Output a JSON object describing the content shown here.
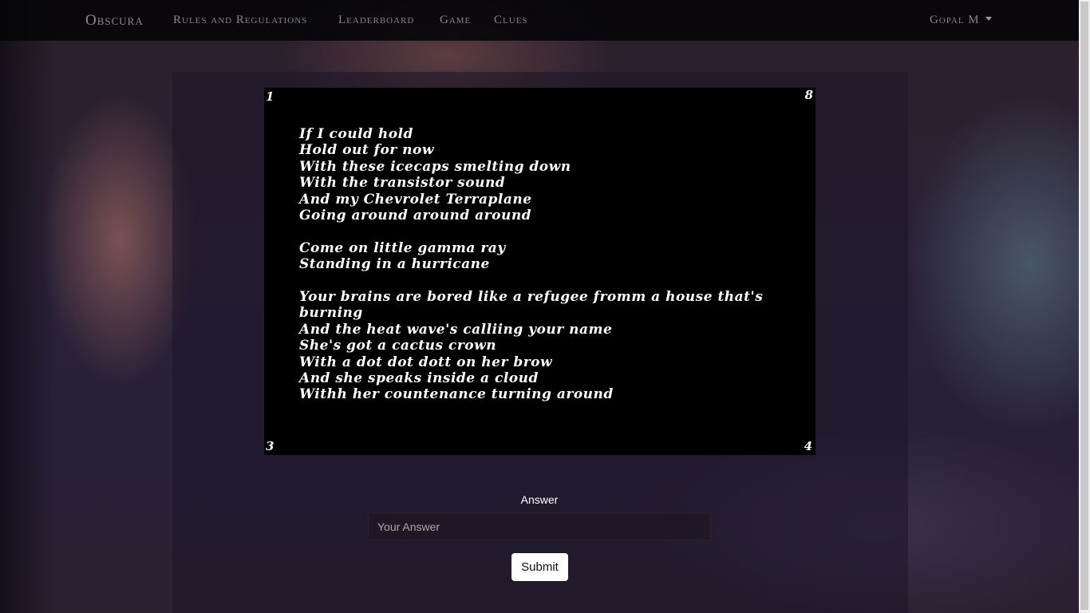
{
  "navbar": {
    "brand": "Obscura",
    "links": [
      "Rules and Regulations",
      "Leaderboard",
      "Game",
      "Clues"
    ],
    "user": "Gopal M"
  },
  "puzzle": {
    "corners": {
      "top_left": "1",
      "top_right": "8",
      "bottom_left": "3",
      "bottom_right": "4"
    },
    "lyrics": [
      "If I could hold",
      "Hold out for now",
      "With these icecaps smelting down",
      "With the transistor sound",
      "And my Chevrolet Terraplane",
      "Going around around around",
      "",
      "Come on little gamma ray",
      "Standing in a hurricane",
      "",
      "Your brains are bored like a refugee fromm a house that's",
      "burning",
      "And the heat wave's calliing your name",
      "She's got a cactus crown",
      "With a dot dot dott on her brow",
      "And she speaks inside a cloud",
      "Withh her countenance turning around"
    ]
  },
  "form": {
    "label": "Answer",
    "placeholder": "Your Answer",
    "value": "",
    "submit_label": "Submit"
  }
}
